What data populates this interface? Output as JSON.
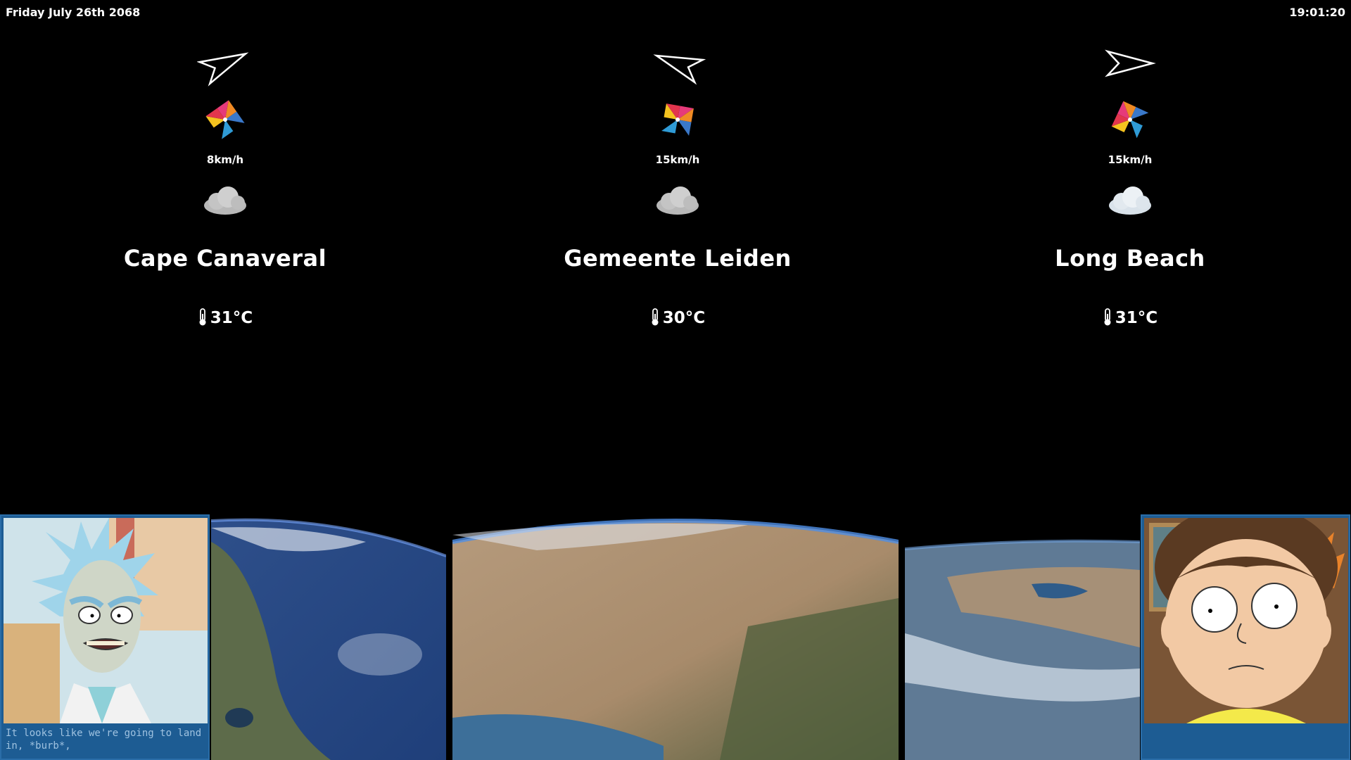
{
  "header": {
    "date": "Friday July 26th 2068",
    "time": "19:01:20"
  },
  "locations": [
    {
      "city": "Cape Canaveral",
      "wind_speed": "8km/h",
      "temperature": "31°C",
      "wind_direction_icon": "navigation-arrow-icon",
      "wind_icon": "pinwheel-icon",
      "weather_icon": "cloud-icon",
      "earth_view": "florida"
    },
    {
      "city": "Gemeente Leiden",
      "wind_speed": "15km/h",
      "temperature": "30°C",
      "wind_direction_icon": "navigation-arrow-icon",
      "wind_icon": "pinwheel-icon",
      "weather_icon": "cloud-icon",
      "earth_view": "continent"
    },
    {
      "city": "Long Beach",
      "wind_speed": "15km/h",
      "temperature": "31°C",
      "wind_direction_icon": "navigation-arrow-icon",
      "wind_icon": "pinwheel-icon",
      "weather_icon": "cloud-icon",
      "earth_view": "coast"
    }
  ],
  "dialogue": {
    "caption": "It looks like we're going to land in, *burb*,"
  },
  "colors": {
    "background": "#000000",
    "text": "#ffffff",
    "portrait_frame": "#1d5c93",
    "caption_text": "#9fc2e0"
  }
}
